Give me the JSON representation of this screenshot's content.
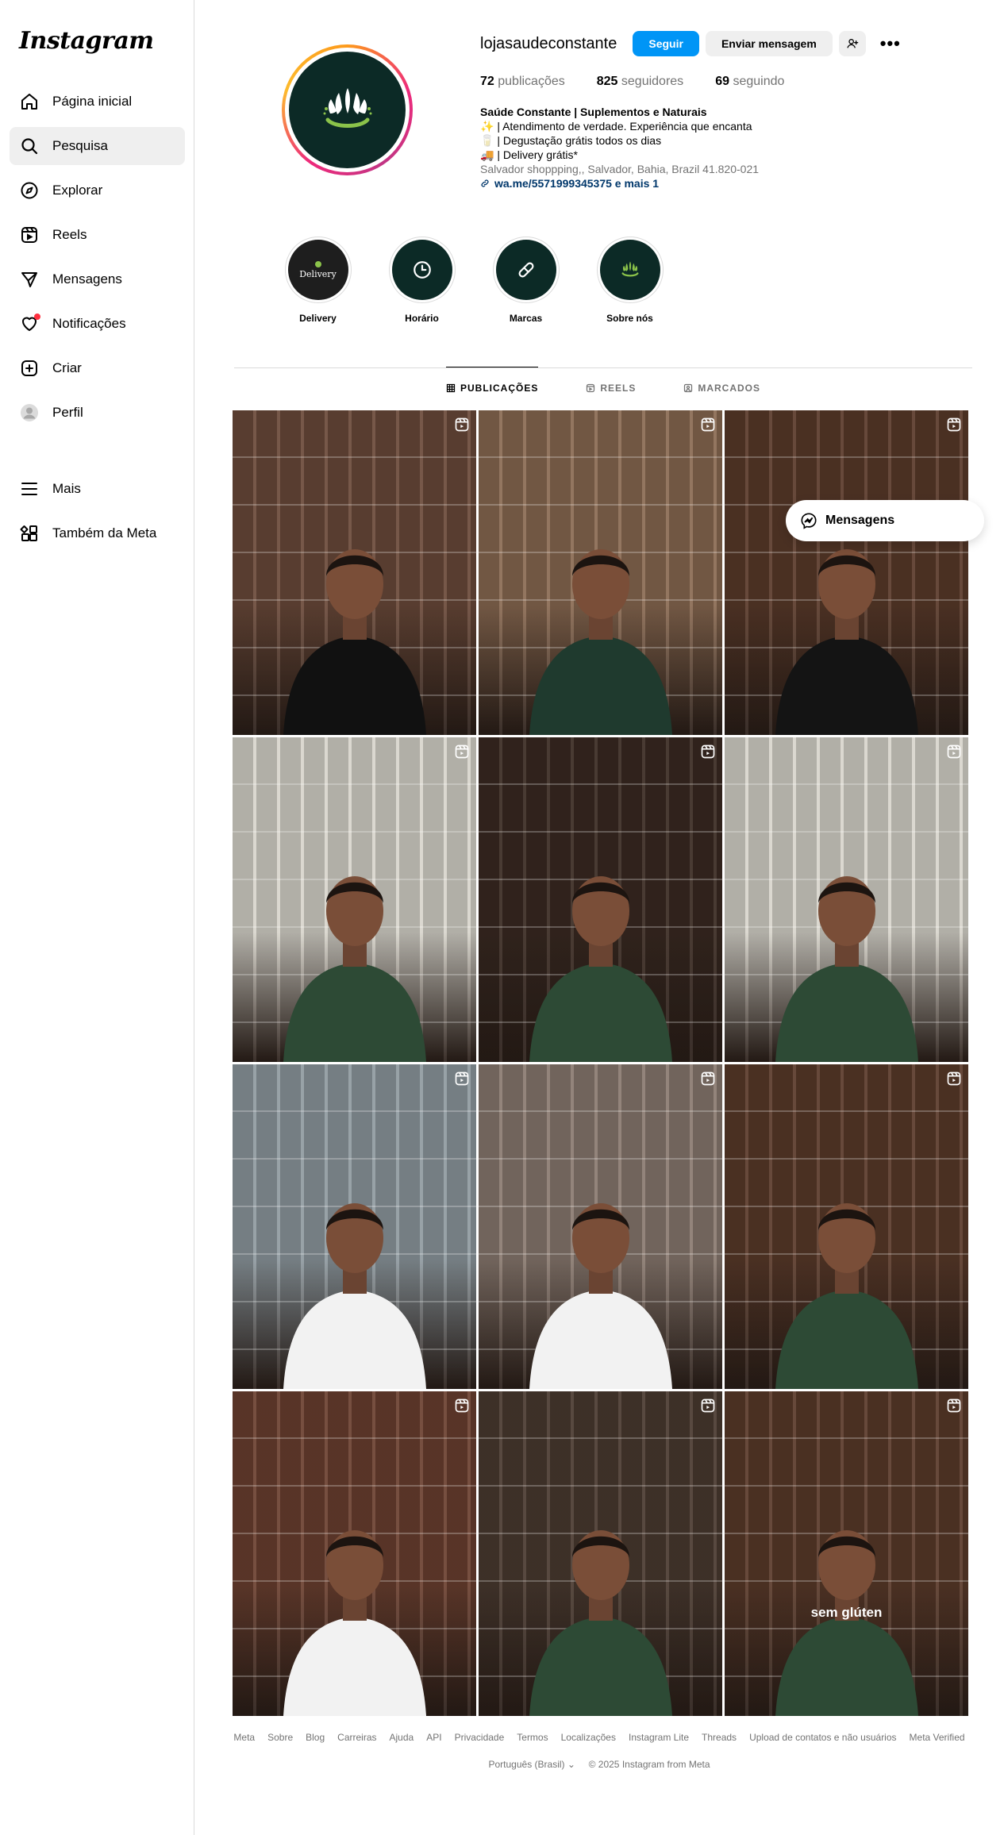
{
  "app": {
    "logo": "Instagram"
  },
  "sidebar": {
    "items": [
      {
        "label": "Página inicial",
        "icon": "home-icon"
      },
      {
        "label": "Pesquisa",
        "icon": "search-icon"
      },
      {
        "label": "Explorar",
        "icon": "compass-icon"
      },
      {
        "label": "Reels",
        "icon": "reels-icon"
      },
      {
        "label": "Mensagens",
        "icon": "send-icon"
      },
      {
        "label": "Notificações",
        "icon": "heart-icon"
      },
      {
        "label": "Criar",
        "icon": "plus-square-icon"
      },
      {
        "label": "Perfil",
        "icon": "profile-avatar-icon"
      }
    ],
    "bottom": [
      {
        "label": "Mais",
        "icon": "menu-icon"
      },
      {
        "label": "Também da Meta",
        "icon": "meta-apps-icon"
      }
    ]
  },
  "profile": {
    "username": "lojasaudeconstante",
    "follow_label": "Seguir",
    "message_label": "Enviar mensagem",
    "stats": {
      "posts_count": "72",
      "posts_label": "publicações",
      "followers_count": "825",
      "followers_label": "seguidores",
      "following_count": "69",
      "following_label": "seguindo"
    },
    "bio": {
      "name": "Saúde Constante | Suplementos e Naturais",
      "line1": "✨ | Atendimento de verdade. Experiência que encanta",
      "line2": "🥛 | Degustação grátis todos os dias",
      "line3": "🚚 | Delivery grátis*",
      "location": "Salvador shoppping,, Salvador, Bahia, Brazil 41.820-021",
      "link": "wa.me/5571999345375 e mais 1"
    }
  },
  "highlights": [
    {
      "label": "Delivery",
      "inner": "Delivery"
    },
    {
      "label": "Horário"
    },
    {
      "label": "Marcas"
    },
    {
      "label": "Sobre nós"
    }
  ],
  "tabs": [
    {
      "label": "PUBLICAÇÕES",
      "icon": "grid-icon",
      "active": true
    },
    {
      "label": "REELS",
      "icon": "reels-icon",
      "active": false
    },
    {
      "label": "MARCADOS",
      "icon": "tagged-icon",
      "active": false
    }
  ],
  "posts": [
    {
      "bg": "#6b4a3a",
      "shirt": "#111111",
      "overlay": ""
    },
    {
      "bg": "#8a6a52",
      "shirt": "#1f3a2e",
      "overlay": ""
    },
    {
      "bg": "#5a3a2a",
      "shirt": "#141414",
      "overlay": ""
    },
    {
      "bg": "#d8d5cc",
      "shirt": "#2d4a35",
      "overlay": ""
    },
    {
      "bg": "#3a2a22",
      "shirt": "#2d4a35",
      "overlay": ""
    },
    {
      "bg": "#d8d5cc",
      "shirt": "#2d4a35",
      "overlay": ""
    },
    {
      "bg": "#8f9aa0",
      "shirt": "#f2f2f2",
      "overlay": ""
    },
    {
      "bg": "#8a7a70",
      "shirt": "#f2f2f2",
      "overlay": ""
    },
    {
      "bg": "#5a3a2a",
      "shirt": "#2d4a35",
      "overlay": ""
    },
    {
      "bg": "#6b4030",
      "shirt": "#f2f2f2",
      "overlay": ""
    },
    {
      "bg": "#4a3a30",
      "shirt": "#2d4a35",
      "overlay": ""
    },
    {
      "bg": "#5a3a2a",
      "shirt": "#2d4a35",
      "overlay": "sem glúten"
    }
  ],
  "messages_pill": {
    "label": "Mensagens"
  },
  "footer": {
    "links": [
      "Meta",
      "Sobre",
      "Blog",
      "Carreiras",
      "Ajuda",
      "API",
      "Privacidade",
      "Termos",
      "Localizações",
      "Instagram Lite",
      "Threads",
      "Upload de contatos e não usuários",
      "Meta Verified"
    ],
    "language": "Português (Brasil)",
    "copyright": "© 2025 Instagram from Meta"
  },
  "colors": {
    "accent": "#0095f6",
    "brand_dark_green": "#0c2a26",
    "leaf_green": "#8bc34a",
    "notification": "#ff3040"
  }
}
